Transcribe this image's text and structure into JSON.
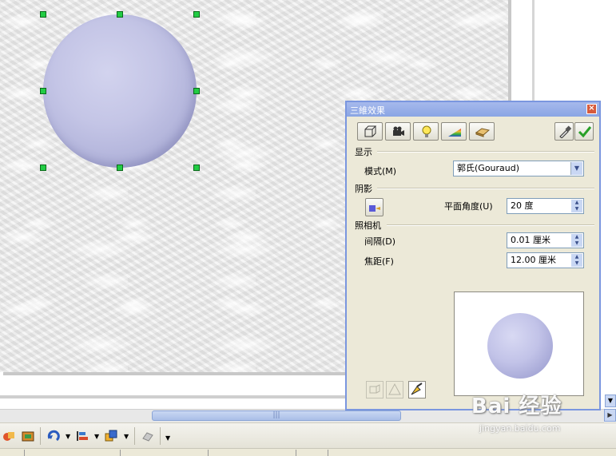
{
  "dialog": {
    "title": "三維效果",
    "close_glyph": "×",
    "toolbar_icons": [
      "geometry-icon",
      "camera-icon",
      "light-bulb-icon",
      "texture-icon",
      "material-icon",
      "eyedropper-icon",
      "apply-check-icon"
    ],
    "sections": {
      "display": "显示",
      "shading": "阴影",
      "camera": "照相机"
    },
    "mode_label": "模式(M)",
    "mode_value": "郭氏(Gouraud)",
    "plane_angle_label": "平面角度(U)",
    "plane_angle_value": "20 度",
    "distance_label": "间隔(D)",
    "distance_value": "0.01 厘米",
    "focal_label": "焦距(F)",
    "focal_value": "12.00 厘米",
    "bottom_icons": [
      "convert-3d-icon",
      "perspective-icon",
      "assign-icon"
    ]
  },
  "canvas": {
    "shape": "sphere",
    "shape_color": "#b8b9e0",
    "handle_color": "#22cc44"
  },
  "toolbar_icons": [
    "shapes-icon",
    "image-icon",
    "rotate-icon",
    "align-icon",
    "arrange-icon",
    "extrusion-icon"
  ],
  "watermark": {
    "logo": "Bai 经验",
    "url": "jingyan.baidu.com"
  }
}
